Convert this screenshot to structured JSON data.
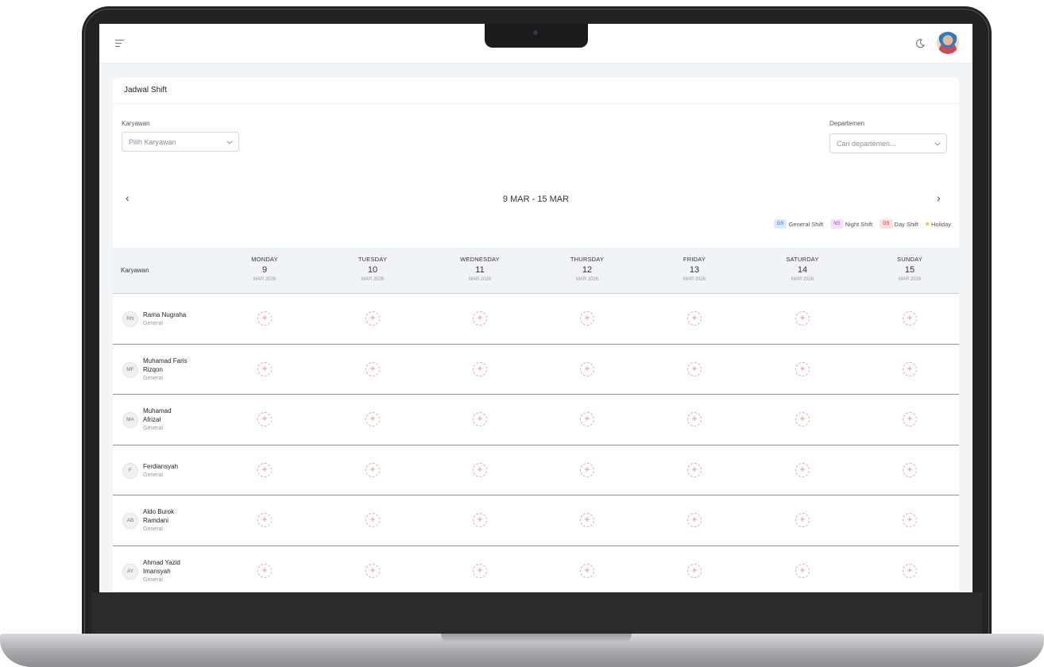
{
  "page_title": "Jadwal Shift",
  "filters": {
    "employee_label": "Karyawan",
    "employee_placeholder": "Pilih Karyawan",
    "department_label": "Departemen",
    "department_placeholder": "Cari departemen..."
  },
  "week": {
    "label": "9 MAR - 15 MAR",
    "prev_icon": "chevron-left-icon",
    "next_icon": "chevron-right-icon"
  },
  "legend": [
    {
      "code": "GS",
      "label": "General Shift",
      "color": "#2b6cb0"
    },
    {
      "code": "NS",
      "label": "Night Shift",
      "color": "#9b3fc4"
    },
    {
      "code": "DS",
      "label": "Day Shift",
      "color": "#c53030"
    },
    {
      "code": "",
      "label": "Holiday",
      "color": "#f6c945"
    }
  ],
  "table": {
    "first_column_header": "Karyawan",
    "days": [
      {
        "name": "MONDAY",
        "day": "9",
        "month": "MAR 2026"
      },
      {
        "name": "TUESDAY",
        "day": "10",
        "month": "MAR 2026"
      },
      {
        "name": "WEDNESDAY",
        "day": "11",
        "month": "MAR 2026"
      },
      {
        "name": "THURSDAY",
        "day": "12",
        "month": "MAR 2026"
      },
      {
        "name": "FRIDAY",
        "day": "13",
        "month": "MAR 2026"
      },
      {
        "name": "SATURDAY",
        "day": "14",
        "month": "MAR 2026"
      },
      {
        "name": "SUNDAY",
        "day": "15",
        "month": "MAR 2026"
      }
    ],
    "employees": [
      {
        "initials": "RN",
        "name_lines": [
          "Rama Nugraha"
        ],
        "department": "General"
      },
      {
        "initials": "MF",
        "name_lines": [
          "Muhamad Faris",
          "Rizqon"
        ],
        "department": "General"
      },
      {
        "initials": "MA",
        "name_lines": [
          "Muhamad",
          "Afrizal"
        ],
        "department": "General"
      },
      {
        "initials": "F",
        "name_lines": [
          "Ferdiansyah"
        ],
        "department": "General"
      },
      {
        "initials": "AB",
        "name_lines": [
          "Aldo Burok",
          "Ramdani"
        ],
        "department": "General"
      },
      {
        "initials": "AY",
        "name_lines": [
          "Ahmad Yazid",
          "Imansyah"
        ],
        "department": "General"
      }
    ],
    "add_icon": "plus-circle-icon",
    "add_symbol": "+"
  },
  "icons": {
    "menu": "hamburger-menu-icon",
    "theme": "moon-icon",
    "profile": "user-avatar"
  }
}
